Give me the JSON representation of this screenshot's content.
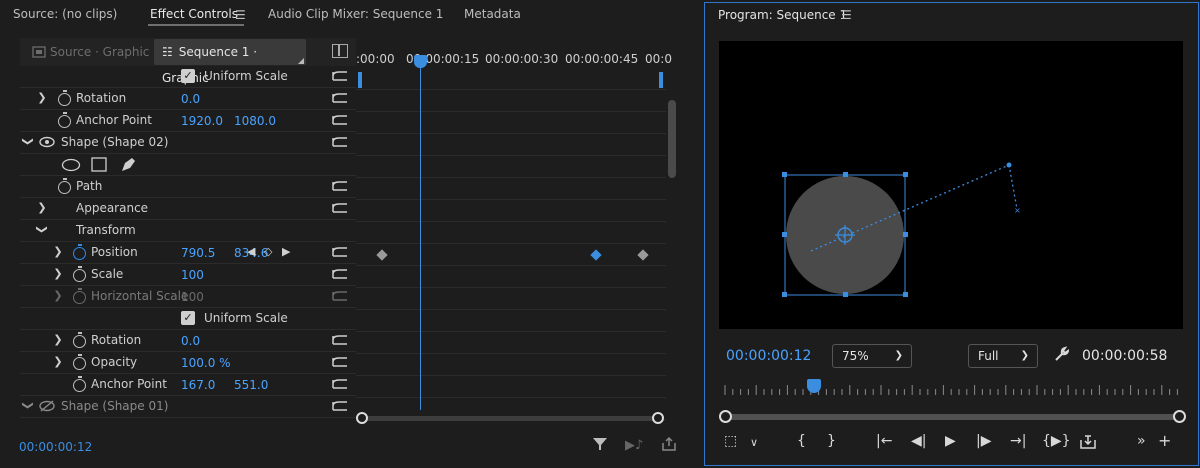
{
  "tabs": {
    "source": "Source: (no clips)",
    "effect_controls": "Effect Controls",
    "audio_mixer": "Audio Clip Mixer: Sequence 1",
    "metadata": "Metadata",
    "menu_icon": "hamburger-menu-icon"
  },
  "effect_controls": {
    "source_tab": "Source · Graphic",
    "sequence_tab": "Sequence 1 · Graphic",
    "rows": {
      "uniform_scale_1": "Uniform Scale",
      "rotation_1": "Rotation",
      "rotation_1_val": "0.0",
      "anchor_1": "Anchor Point",
      "anchor_1_x": "1920.0",
      "anchor_1_y": "1080.0",
      "shape2": "Shape (Shape 02)",
      "path": "Path",
      "appearance": "Appearance",
      "transform": "Transform",
      "position": "Position",
      "position_x": "790.5",
      "position_y": "834.6",
      "scale": "Scale",
      "scale_val": "100",
      "hscale": "Horizontal Scale",
      "hscale_val": "100",
      "uniform_scale_2": "Uniform Scale",
      "rotation_2": "Rotation",
      "rotation_2_val": "0.0",
      "opacity": "Opacity",
      "opacity_val": "100.0 %",
      "anchor_2": "Anchor Point",
      "anchor_2_x": "167.0",
      "anchor_2_y": "551.0",
      "shape1": "Shape (Shape 01)"
    },
    "timecode": "00:00:00:12"
  },
  "timeline": {
    "ruler_labels": [
      ":00:00",
      "00:00:00:15",
      "00:00:00:30",
      "00:00:00:45",
      "00:0"
    ]
  },
  "program": {
    "title": "Program: Sequence 1",
    "current_timecode": "00:00:00:12",
    "zoom": "75%",
    "quality": "Full",
    "duration": "00:00:00:58"
  },
  "colors": {
    "accent": "#3b8de0",
    "value_blue": "#4aa3ff",
    "background": "#1d1d1d"
  }
}
